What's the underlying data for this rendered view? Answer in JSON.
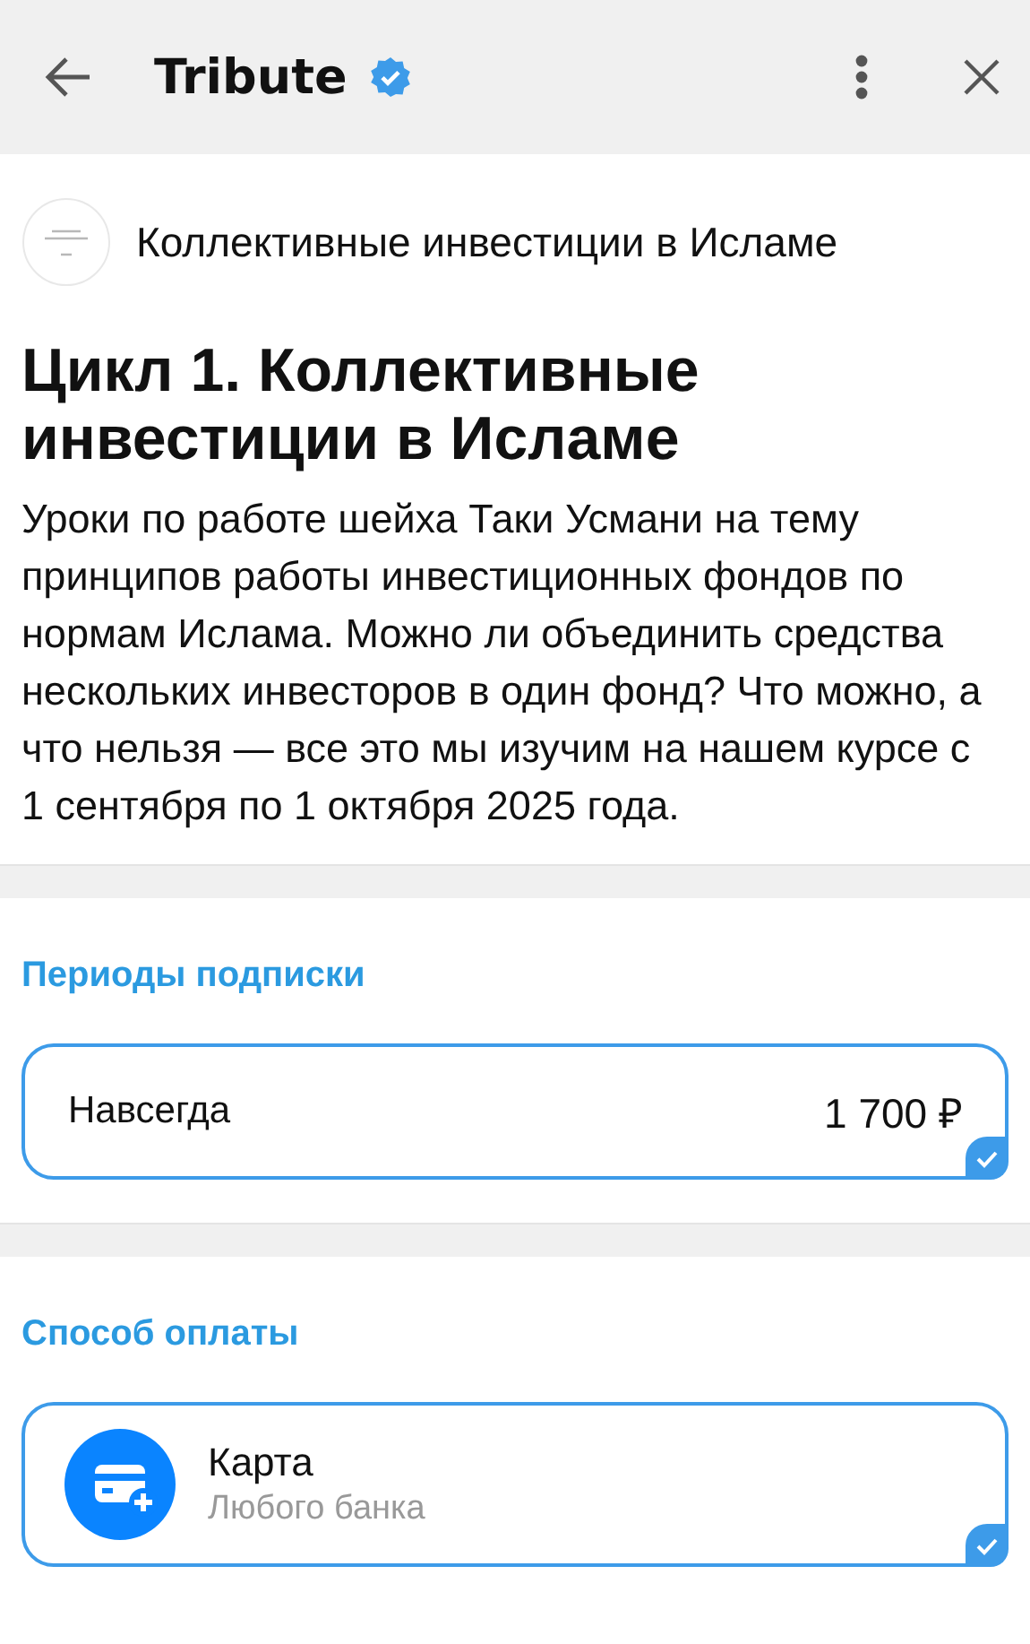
{
  "header": {
    "title": "Tribute",
    "verified": true
  },
  "channel": {
    "name": "Коллективные инвестиции в Исламе"
  },
  "product": {
    "title": "Цикл 1. Коллективные инвестиции в Исламе",
    "description": "Уроки по работе шейха Таки Усмани на тему принципов работы инвестиционных фондов по нормам Ислама. Можно ли объединить средства нескольких инвесторов в один фонд? Что можно, а что нельзя — все это мы изучим на нашем курсе с 1 сентября по 1 октября 2025 года."
  },
  "periods": {
    "heading": "Периоды подписки",
    "options": [
      {
        "label": "Навсегда",
        "price": "1 700 ₽",
        "selected": true
      }
    ]
  },
  "payment": {
    "heading": "Способ оплаты",
    "methods": [
      {
        "kind": "card",
        "label": "Карта",
        "sublabel": "Любого банка",
        "selected": true
      }
    ]
  }
}
